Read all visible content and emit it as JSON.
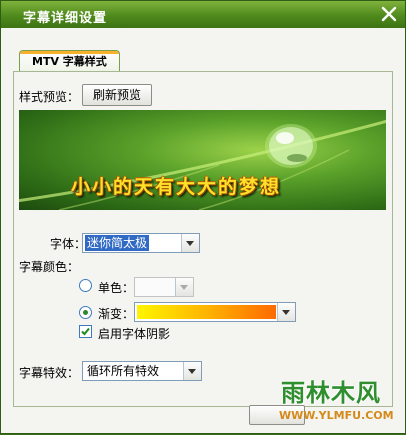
{
  "window": {
    "title": "字幕详细设置"
  },
  "tabs": [
    {
      "label": "MTV 字幕样式"
    }
  ],
  "preview": {
    "label": "样式预览：",
    "refresh_button": "刷新预览",
    "lyric_text": "小小的天有大大的梦想"
  },
  "font": {
    "label": "字体：",
    "value": "迷你简太极"
  },
  "subtitle_color": {
    "label": "字幕颜色：",
    "solid_label": "单色：",
    "gradient_label": "渐变：",
    "selected_mode": "gradient",
    "gradient_colors": [
      "#fff500",
      "#ffb400",
      "#ff6a00"
    ],
    "shadow_label": "启用字体阴影",
    "shadow_checked": true
  },
  "effects": {
    "label": "字幕特效：",
    "value": "循环所有特效"
  },
  "watermark": {
    "title": "雨林木风",
    "url": "WWW.YLMFU.COM"
  },
  "colors": {
    "titlebar": "#4f8a1d",
    "tab_accent": "#f7b22d",
    "selection": "#316ac5"
  }
}
